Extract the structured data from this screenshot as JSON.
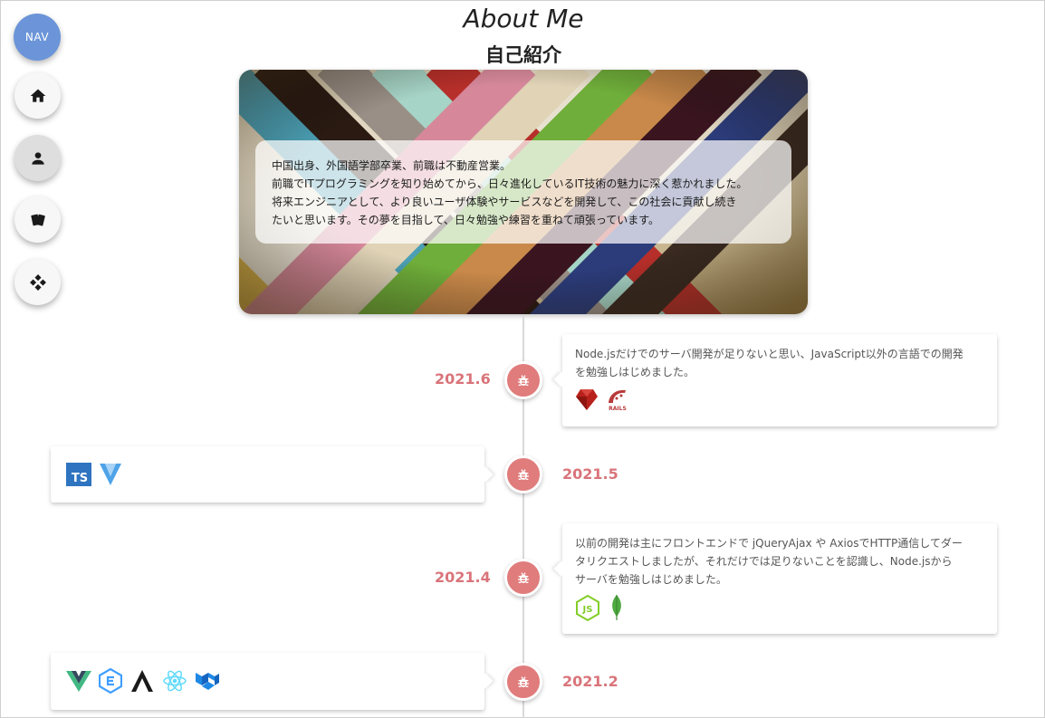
{
  "nav": {
    "toggle_label": "NAV",
    "items": [
      {
        "icon": "home-icon"
      },
      {
        "icon": "person-icon",
        "active": true
      },
      {
        "icon": "cards-icon"
      },
      {
        "icon": "apps-icon"
      }
    ]
  },
  "header": {
    "title_en": "About Me",
    "title_ja": "自己紹介"
  },
  "intro": {
    "lines": [
      "中国出身、外国語学部卒業、前職は不動産営業。",
      "前職でITプログラミングを知り始めてから、日々進化しているIT技術の魅力に深く惹かれました。",
      "将来エンジニアとして、より良いユーザ体験やサービスなどを開発して、この社会に貢献し続き",
      "たいと思います。その夢を目指して、日々勉強や練習を重ねて頑張っています。"
    ]
  },
  "timeline": [
    {
      "date": "2021.6",
      "side": "right",
      "lines": [
        "Node.jsだけでのサーバ開発が足りないと思い、JavaScript以外の言語での開発",
        "を勉強しはじめました。"
      ],
      "icons": [
        "ruby-icon",
        "rails-icon"
      ],
      "rails_badge_text": "RAILS"
    },
    {
      "date": "2021.5",
      "side": "left",
      "lines": [],
      "icons": [
        "typescript-icon",
        "vite-icon"
      ],
      "ts_badge_text": "TS"
    },
    {
      "date": "2021.4",
      "side": "right",
      "lines": [
        "以前の開発は主にフロントエンドで jQueryAjax や AxiosでHTTP通信してダー",
        "タリクエストしましたが、それだけでは足りないことを認識し、Node.jsから",
        "サーバを勉強しはじめました。"
      ],
      "icons": [
        "nodejs-icon",
        "mongodb-icon"
      ],
      "node_badge_text": "JS"
    },
    {
      "date": "2021.2",
      "side": "left",
      "lines": [],
      "icons": [
        "vue-icon",
        "element-icon",
        "ant-design-icon",
        "react-icon",
        "material-ui-icon"
      ]
    }
  ],
  "colors": {
    "accent_red": "#e07c7c",
    "date_red": "#d9747a",
    "nav_blue": "#6b95d8"
  }
}
